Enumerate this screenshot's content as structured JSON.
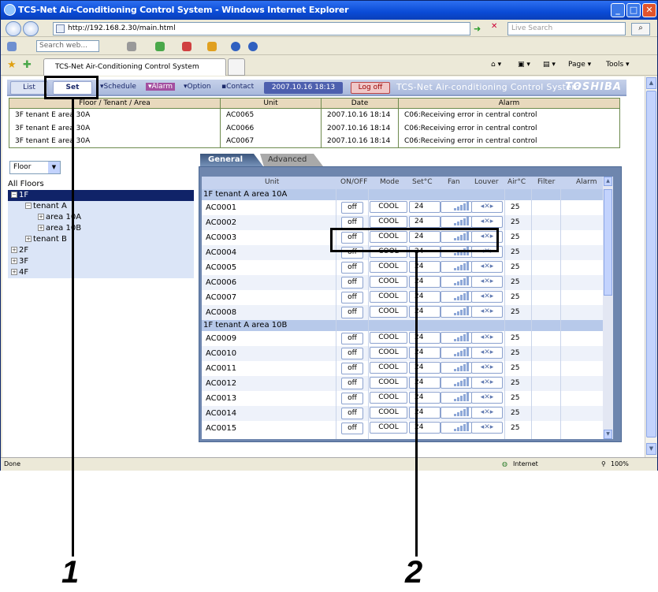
{
  "browser": {
    "title": "TCS-Net Air-Conditioning Control System - Windows Internet Explorer",
    "address": "http://192.168.2.30/main.html",
    "search_placeholder": "Live Search",
    "toolbar_search": "Search web...",
    "tab_title": "TCS-Net Air-Conditioning Control System",
    "page_menu": "Page",
    "tools_menu": "Tools",
    "status_left": "Done",
    "status_zone": "Internet",
    "zoom": "100%"
  },
  "app": {
    "list_label": "List",
    "set_label": "Set",
    "schedule_label": "▾Schedule",
    "alarm_label": "▾Alarm",
    "option_label": "▾Option",
    "contact_label": "▪Contact",
    "datetime": "2007.10.16 18:13",
    "logoff_label": "Log off",
    "app_name": "TCS-Net Air-conditioning Control System",
    "brand": "TOSHIBA"
  },
  "alarm_table": {
    "headers": [
      "Floor / Tenant / Area",
      "Unit",
      "Date",
      "Alarm"
    ],
    "rows": [
      [
        "3F tenant E area 30A",
        "AC0065",
        "2007.10.16 18:14",
        "C06:Receiving error in central control"
      ],
      [
        "3F tenant E area 30A",
        "AC0066",
        "2007.10.16 18:14",
        "C06:Receiving error in central control"
      ],
      [
        "3F tenant E area 30A",
        "AC0067",
        "2007.10.16 18:14",
        "C06:Receiving error in central control"
      ]
    ]
  },
  "tree": {
    "floor_select": "Floor",
    "root": "All Floors",
    "nodes": [
      "1F",
      "tenant A",
      "area 10A",
      "area 10B",
      "tenant B",
      "2F",
      "3F",
      "4F"
    ]
  },
  "tabs": {
    "general": "General",
    "advanced": "Advanced"
  },
  "grid": {
    "headers": [
      "Unit",
      "ON/OFF",
      "Mode",
      "Set°C",
      "Fan",
      "Louver",
      "Air°C",
      "Filter",
      "Alarm"
    ],
    "group_a": "1F tenant A area 10A",
    "group_b": "1F tenant A area 10B",
    "rows_a": [
      {
        "unit": "AC0001",
        "onoff": "off",
        "mode": "COOL",
        "set": "24",
        "air": "25"
      },
      {
        "unit": "AC0002",
        "onoff": "off",
        "mode": "COOL",
        "set": "24",
        "air": "25"
      },
      {
        "unit": "AC0003",
        "onoff": "off",
        "mode": "COOL",
        "set": "24",
        "air": "25"
      },
      {
        "unit": "AC0004",
        "onoff": "off",
        "mode": "COOL",
        "set": "24",
        "air": "25"
      },
      {
        "unit": "AC0005",
        "onoff": "off",
        "mode": "COOL",
        "set": "24",
        "air": "25"
      },
      {
        "unit": "AC0006",
        "onoff": "off",
        "mode": "COOL",
        "set": "24",
        "air": "25"
      },
      {
        "unit": "AC0007",
        "onoff": "off",
        "mode": "COOL",
        "set": "24",
        "air": "25"
      },
      {
        "unit": "AC0008",
        "onoff": "off",
        "mode": "COOL",
        "set": "24",
        "air": "25"
      }
    ],
    "rows_b": [
      {
        "unit": "AC0009",
        "onoff": "off",
        "mode": "COOL",
        "set": "24",
        "air": "25"
      },
      {
        "unit": "AC0010",
        "onoff": "off",
        "mode": "COOL",
        "set": "24",
        "air": "25"
      },
      {
        "unit": "AC0011",
        "onoff": "off",
        "mode": "COOL",
        "set": "24",
        "air": "25"
      },
      {
        "unit": "AC0012",
        "onoff": "off",
        "mode": "COOL",
        "set": "24",
        "air": "25"
      },
      {
        "unit": "AC0013",
        "onoff": "off",
        "mode": "COOL",
        "set": "24",
        "air": "25"
      },
      {
        "unit": "AC0014",
        "onoff": "off",
        "mode": "COOL",
        "set": "24",
        "air": "25"
      },
      {
        "unit": "AC0015",
        "onoff": "off",
        "mode": "COOL",
        "set": "24",
        "air": "25"
      }
    ],
    "louver_glyph": "◂✕▸"
  },
  "callouts": {
    "one": "1",
    "two": "2"
  },
  "colors": {
    "title_blue": "#0a4bd6",
    "tree_selected": "#102368",
    "panel": "#6e86ae"
  }
}
